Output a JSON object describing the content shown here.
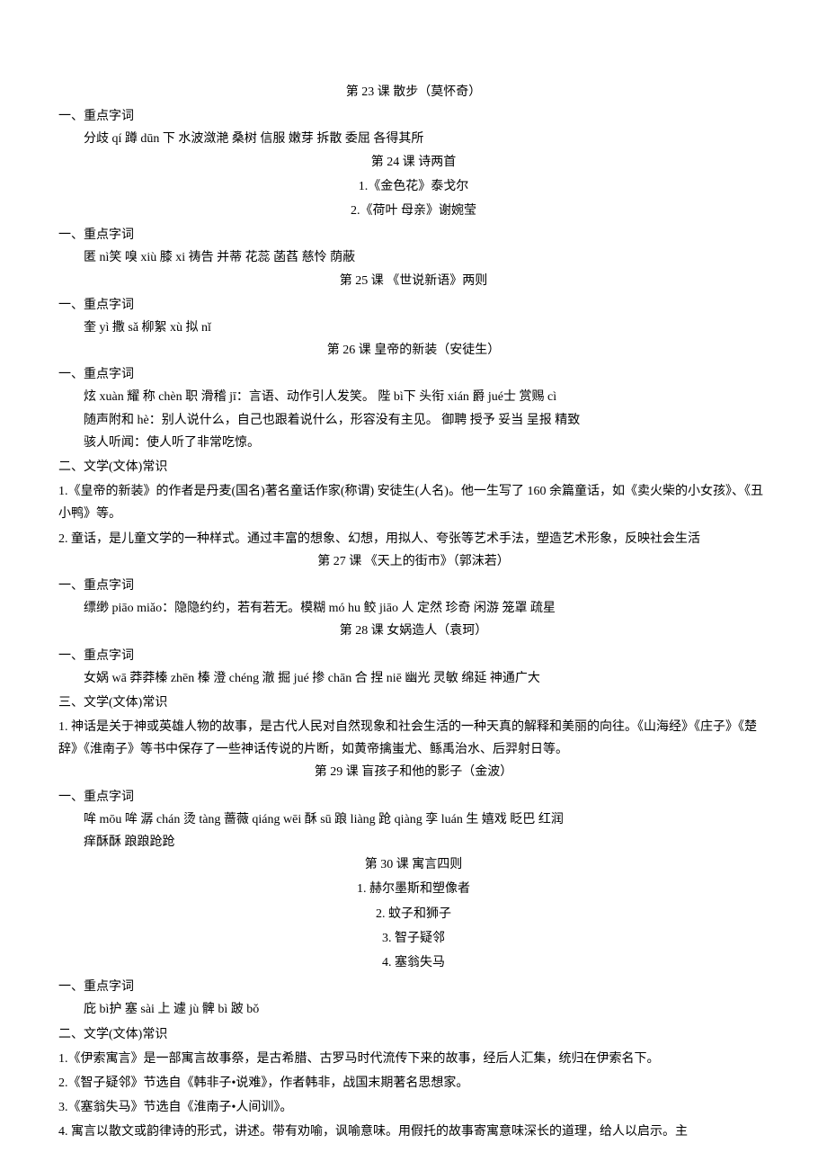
{
  "lesson23": {
    "title": "第 23 课   散步（莫怀奇）",
    "section1": "一、重点字词",
    "content1": "分歧 qí    蹲 dūn 下   水波潋滟   桑树   信服   嫩芽   拆散   委屈   各得其所"
  },
  "lesson24": {
    "title": "第 24 课  诗两首",
    "sub1": "1.《金色花》泰戈尔",
    "sub2": "2.《荷叶   母亲》谢婉莹",
    "section1": "一、重点字词",
    "content1": "匿 nì笑     嗅 xiù     膝 xi   祷告   并蒂   花蕊   菡萏   慈怜   荫蔽"
  },
  "lesson25": {
    "title": "第 25 课   《世说新语》两则",
    "section1": "一、重点字词",
    "content1": "奎 yì   撒 sǎ   柳絮 xù   拟 nǐ"
  },
  "lesson26": {
    "title": "第 26 课   皇帝的新装（安徒生）",
    "section1": "一、重点字词",
    "content1": "炫 xuàn 耀  称 chèn 职   滑稽 jī：言语、动作引人发笑。  陛 bì下  头衔 xián   爵 jué士   赏赐 cì",
    "content2": "随声附和 hè：别人说什么，自己也跟着说什么，形容没有主见。  御聘   授予   妥当   呈报   精致",
    "content3": "骇人听闻：使人听了非常吃惊。",
    "section2": "二、文学(文体)常识",
    "lit1": "1.《皇帝的新装》的作者是丹麦(国名)著名童话作家(称谓) 安徒生(人名)。他一生写了 160 余篇童话，如《卖火柴的小女孩》、《丑小鸭》等。",
    "lit2": "2. 童话，是儿童文学的一种样式。通过丰富的想象、幻想，用拟人、夸张等艺术手法，塑造艺术形象，反映社会生活"
  },
  "lesson27": {
    "title": "第 27 课   《天上的街市》（郭沫若）",
    "section1": "一、重点字词",
    "content1": "缥缈 piāo miǎo：隐隐约约，若有若无。模糊 mó hu   鲛 jiāo 人   定然   珍奇   闲游   笼罩   疏星"
  },
  "lesson28": {
    "title": "第 28 课   女娲造人（袁珂）",
    "section1": "一、重点字词",
    "content1": "女娲 wā   莽莽榛 zhēn 榛   澄 chéng 澈  掘 jué   掺 chān 合   捏 niē   幽光   灵敏   绵延   神通广大",
    "section3": "三、文学(文体)常识",
    "lit1": "1. 神话是关于神或英雄人物的故事，是古代人民对自然现象和社会生活的一种天真的解释和美丽的向往。《山海经》《庄子》《楚辞》《淮南子》等书中保存了一些神话传说的片断，如黄帝擒蚩尤、鲧禹治水、后羿射日等。"
  },
  "lesson29": {
    "title": "第 29 课   盲孩子和他的影子（金波）",
    "section1": "一、重点字词",
    "content1": "哞 mōu 哞   潺 chán   烫 tàng 蔷薇 qiáng wēi  酥 sū   踉 liàng 跄 qiàng   孪 luán 生   嬉戏   眨巴   红润",
    "content2": "痒酥酥   踉踉跄跄"
  },
  "lesson30": {
    "title": "第 30 课  寓言四则",
    "sub1": "1. 赫尔墨斯和塑像者",
    "sub2": "2. 蚊子和狮子",
    "sub3": "3. 智子疑邻",
    "sub4": "4. 塞翁失马",
    "section1": "一、重点字词",
    "content1": "庇 bì护    塞 sài 上    遽 jù   髀 bì   跛 bǒ",
    "section2": "二、文学(文体)常识",
    "lit1": "1.《伊索寓言》是一部寓言故事祭，是古希腊、古罗马时代流传下来的故事，经后人汇集，统归在伊索名下。",
    "lit2": "2.《智子疑邻》节选自《韩非子•说难》，作者韩非，战国末期著名思想家。",
    "lit3": "3.《塞翁失马》节选自《淮南子•人间训》。",
    "lit4": "4. 寓言以散文或韵律诗的形式，讲述。带有劝喻，讽喻意味。用假托的故事寄寓意味深长的道理，给人以启示。主"
  }
}
